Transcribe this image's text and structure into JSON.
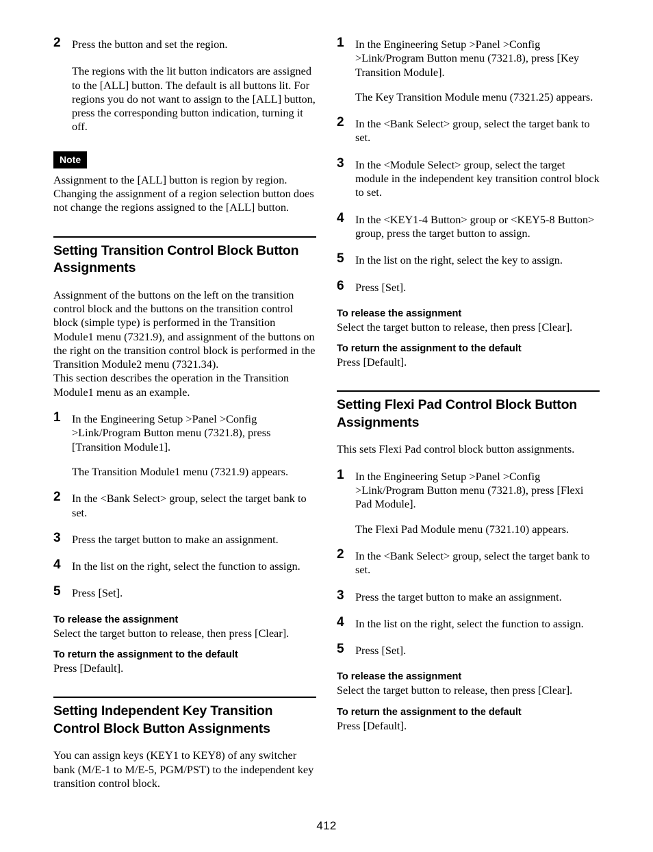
{
  "page": {
    "number": "412"
  },
  "left_column": {
    "step2": {
      "num": "2",
      "text": "Press the button and set the region."
    },
    "step2_detail": "The regions with the lit button indicators are assigned to the [ALL] button. The default is all buttons lit. For regions you do not want to assign to the [ALL] button, press the corresponding button indication, turning it off.",
    "note": {
      "label": "Note",
      "text": "Assignment to the [ALL] button is region by region. Changing the assignment of a region selection button does not change the regions assigned to the [ALL] button."
    },
    "section1": {
      "title": "Setting Transition Control Block Button Assignments",
      "intro": "Assignment of the buttons on the left on the transition control block and the buttons on the transition control block (simple type) is performed in the Transition Module1 menu (7321.9), and assignment of the buttons on the right on the transition control block is performed in the Transition Module2 menu (7321.34).",
      "intro2": "This section describes the operation in the Transition Module1 menu as an example.",
      "steps": [
        {
          "num": "1",
          "text": "In the Engineering Setup >Panel >Config >Link/Program Button menu (7321.8), press [Transition Module1].",
          "result": "The Transition Module1 menu (7321.9) appears."
        },
        {
          "num": "2",
          "text": "In the <Bank Select> group, select the target bank to set."
        },
        {
          "num": "3",
          "text": "Press the target button to make an assignment."
        },
        {
          "num": "4",
          "text": "In the list on the right, select the function to assign."
        },
        {
          "num": "5",
          "text": "Press [Set]."
        }
      ],
      "release_heading": "To release the assignment",
      "release_text": "Select the target button to release, then press [Clear].",
      "default_heading": "To return the assignment to the default",
      "default_text": "Press [Default]."
    },
    "section2": {
      "title": "Setting Independent Key Transition Control Block Button Assignments",
      "intro": "You can assign keys (KEY1 to KEY8) of any switcher bank (M/E-1 to M/E-5, PGM/PST) to the independent key transition control block."
    }
  },
  "right_column": {
    "section2_steps": [
      {
        "num": "1",
        "text": "In the Engineering Setup >Panel >Config >Link/Program Button menu (7321.8), press [Key Transition Module].",
        "result": "The Key Transition Module menu (7321.25) appears."
      },
      {
        "num": "2",
        "text": "In the <Bank Select> group, select the target bank to set."
      },
      {
        "num": "3",
        "text": "In the <Module Select> group, select the target module in the independent key transition control block to set."
      },
      {
        "num": "4",
        "text": "In the <KEY1-4 Button> group or <KEY5-8 Button> group, press the target button to assign."
      },
      {
        "num": "5",
        "text": "In the list on the right, select the key to assign."
      },
      {
        "num": "6",
        "text": "Press [Set]."
      }
    ],
    "section2_release_heading": "To release the assignment",
    "section2_release_text": "Select the target button to release, then press [Clear].",
    "section2_default_heading": "To return the assignment to the default",
    "section2_default_text": "Press [Default].",
    "section3": {
      "title": "Setting Flexi Pad Control Block Button Assignments",
      "intro": "This sets Flexi Pad control block button assignments.",
      "steps": [
        {
          "num": "1",
          "text": "In the Engineering Setup >Panel >Config >Link/Program Button menu (7321.8), press [Flexi Pad Module].",
          "result": "The Flexi Pad Module menu (7321.10) appears."
        },
        {
          "num": "2",
          "text": "In the <Bank Select> group, select the target bank to set."
        },
        {
          "num": "3",
          "text": "Press the target button to make an assignment."
        },
        {
          "num": "4",
          "text": "In the list on the right, select the function to assign."
        },
        {
          "num": "5",
          "text": "Press [Set]."
        }
      ],
      "release_heading": "To release the assignment",
      "release_text": "Select the target button to release, then press [Clear].",
      "default_heading": "To return the assignment to the default",
      "default_text": "Press [Default]."
    }
  }
}
